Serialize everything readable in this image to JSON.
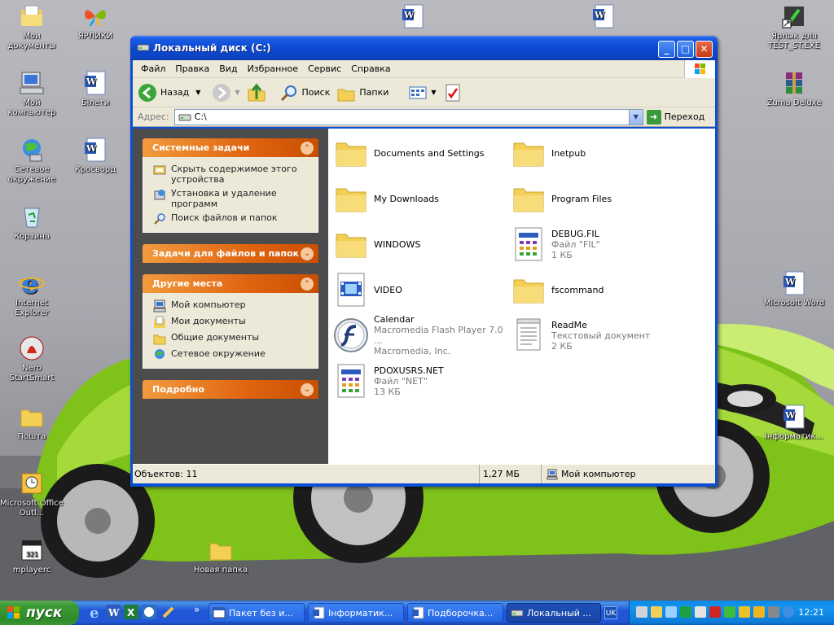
{
  "desktop": {
    "icons_left": [
      {
        "label": "Мои документы",
        "icon": "my-documents-icon"
      },
      {
        "label": "Мой компьютер",
        "icon": "my-computer-icon"
      },
      {
        "label": "Сетевое окружение",
        "icon": "network-icon"
      },
      {
        "label": "Корзина",
        "icon": "recycle-bin-icon"
      },
      {
        "label": "Internet Explorer",
        "icon": "ie-icon"
      },
      {
        "label": "Nero StartSmart",
        "icon": "nero-icon"
      },
      {
        "label": "Пошта",
        "icon": "folder-icon"
      },
      {
        "label": "Microsoft Office Outl...",
        "icon": "outlook-icon"
      },
      {
        "label": "mplayerc",
        "icon": "mplayer-icon"
      }
    ],
    "icons_col2": [
      {
        "label": "ЯРЛИКИ",
        "icon": "msn-butterfly-icon"
      },
      {
        "label": "Білети",
        "icon": "word-doc-icon"
      },
      {
        "label": "Кросворд",
        "icon": "word-doc-icon"
      }
    ],
    "icons_right": [
      {
        "label": "Ярлык для TEST_ST.EXE",
        "icon": "exe-shortcut-icon"
      },
      {
        "label": "Zuma Deluxe",
        "icon": "winrar-icon"
      },
      {
        "label": "Microsoft Word",
        "icon": "word-doc-icon"
      },
      {
        "label": "Інформатик...",
        "icon": "word-doc-icon"
      }
    ],
    "icon_bottom": {
      "label": "Новая папка",
      "icon": "folder-icon"
    }
  },
  "window": {
    "title": "Локальный диск (C:)",
    "menu": [
      "Файл",
      "Правка",
      "Вид",
      "Избранное",
      "Сервис",
      "Справка"
    ],
    "toolbar": {
      "back_label": "Назад",
      "search_label": "Поиск",
      "folders_label": "Папки"
    },
    "address": {
      "label": "Адрес:",
      "value": "C:\\",
      "go_label": "Переход"
    },
    "panels": [
      {
        "title": "Системные задачи",
        "expanded": true,
        "items": [
          {
            "label": "Скрыть содержимое этого устройства",
            "icon": "hide-contents-icon"
          },
          {
            "label": "Установка и удаление программ",
            "icon": "add-remove-programs-icon"
          },
          {
            "label": "Поиск файлов и папок",
            "icon": "search-icon"
          }
        ]
      },
      {
        "title": "Задачи для файлов и папок",
        "expanded": false,
        "items": []
      },
      {
        "title": "Другие места",
        "expanded": true,
        "items": [
          {
            "label": "Мой компьютер",
            "icon": "my-computer-icon"
          },
          {
            "label": "Мои документы",
            "icon": "my-documents-icon"
          },
          {
            "label": "Общие документы",
            "icon": "shared-documents-icon"
          },
          {
            "label": "Сетевое окружение",
            "icon": "network-icon"
          }
        ]
      },
      {
        "title": "Подробно",
        "expanded": false,
        "items": []
      }
    ],
    "files": [
      {
        "name": "Documents and Settings",
        "type": "folder",
        "icon": "folder-icon"
      },
      {
        "name": "Inetpub",
        "type": "folder",
        "icon": "folder-icon"
      },
      {
        "name": "My Downloads",
        "type": "folder",
        "icon": "folder-icon"
      },
      {
        "name": "Program Files",
        "type": "folder",
        "icon": "folder-icon"
      },
      {
        "name": "WINDOWS",
        "type": "folder",
        "icon": "folder-icon"
      },
      {
        "name": "DEBUG.FIL",
        "type": "Файл \"FIL\"",
        "size": "1 КБ",
        "icon": "system-file-icon"
      },
      {
        "name": "VIDEO",
        "type": "folder",
        "icon": "video-folder-icon"
      },
      {
        "name": "fscommand",
        "type": "folder",
        "icon": "folder-icon"
      },
      {
        "name": "Calendar",
        "type": "Macromedia Flash Player 7.0 ...",
        "size": "Macromedia, Inc.",
        "icon": "flash-icon"
      },
      {
        "name": "ReadMe",
        "type": "Текстовый документ",
        "size": "2 КБ",
        "icon": "text-document-icon"
      },
      {
        "name": "PDOXUSRS.NET",
        "type": "Файл \"NET\"",
        "size": "13 КБ",
        "icon": "system-file-icon"
      }
    ],
    "status": {
      "objects": "Объектов: 11",
      "size": "1,27 МБ",
      "location": "Мой компьютер"
    }
  },
  "taskbar": {
    "start_label": "пуск",
    "buttons": [
      {
        "label": "Пакет без и...",
        "active": false
      },
      {
        "label": "Інформатик...",
        "active": false
      },
      {
        "label": "Подборочка...",
        "active": false
      },
      {
        "label": "Локальный ...",
        "active": true
      }
    ],
    "overflow": "»",
    "lang": "UK",
    "clock": "12:21"
  }
}
